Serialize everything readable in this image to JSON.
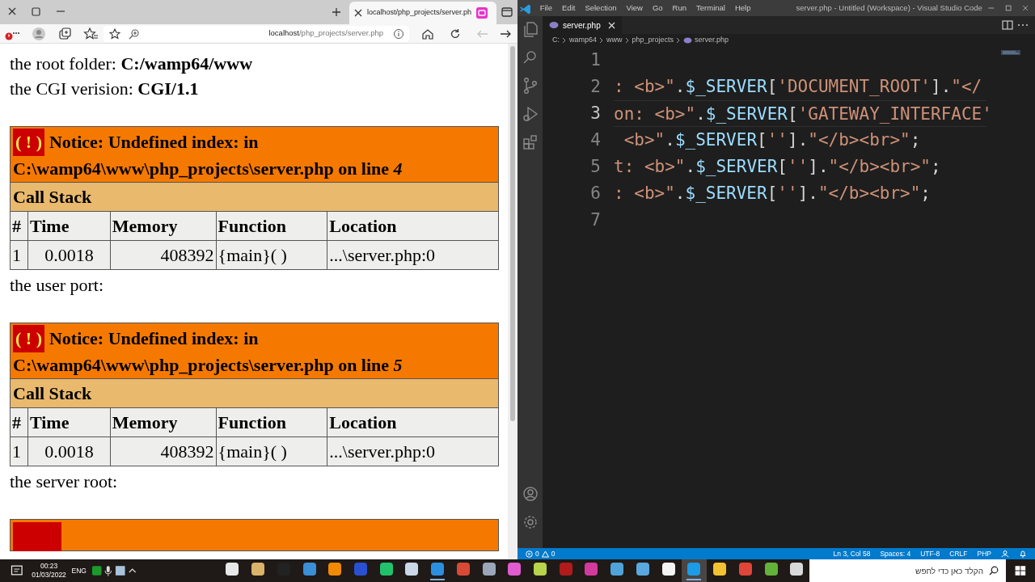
{
  "browser": {
    "tab": {
      "title": "localhost/php_projects/server.ph"
    },
    "address": {
      "host": "localhost",
      "path": "/php_projects/server.php"
    },
    "page": [
      {
        "kind": "text",
        "text": "the root folder: **C:/wamp64/www**"
      },
      {
        "kind": "text",
        "text": "the CGI verision: **CGI/1.1**"
      },
      {
        "kind": "notice",
        "badge": "( ! )",
        "message": "Notice: Undefined index: in C:\\wamp64\\www\\php_projects\\server.php on line *4*",
        "stack_title": "Call Stack",
        "columns": [
          "#",
          "Time",
          "Memory",
          "Function",
          "Location"
        ],
        "rows": [
          [
            "1",
            "0.0018",
            "408392",
            "{main}( )",
            "...\\server.php:0"
          ]
        ]
      },
      {
        "kind": "text",
        "text": "the user port:"
      },
      {
        "kind": "notice",
        "badge": "( ! )",
        "message": "Notice: Undefined index: in C:\\wamp64\\www\\php_projects\\server.php on line *5*",
        "stack_title": "Call Stack",
        "columns": [
          "#",
          "Time",
          "Memory",
          "Function",
          "Location"
        ],
        "rows": [
          [
            "1",
            "0.0018",
            "408392",
            "{main}( )",
            "...\\server.php:0"
          ]
        ]
      },
      {
        "kind": "text",
        "text": "the server root:"
      },
      {
        "kind": "notice_cut"
      }
    ]
  },
  "vscode": {
    "menu": [
      "File",
      "Edit",
      "Selection",
      "View",
      "Go",
      "Run",
      "Terminal",
      "Help"
    ],
    "title": "server.php - Untitled (Workspace) - Visual Studio Code",
    "tabs": [
      {
        "label": "server.php",
        "selected": true
      }
    ],
    "breadcrumb": [
      "C:",
      "wamp64",
      "www",
      "php_projects",
      "server.php"
    ],
    "lines": [
      {
        "number": "1",
        "current": false
      },
      {
        "number": "2",
        "current": false,
        "tokens": [
          {
            "kind": "str",
            "text": ": <b>\""
          },
          {
            "kind": "op",
            "text": "."
          },
          {
            "kind": "var",
            "text": "$_SERVER"
          },
          {
            "kind": "op",
            "text": "["
          },
          {
            "kind": "str",
            "text": "'DOCUMENT_ROOT'"
          },
          {
            "kind": "op",
            "text": "]."
          },
          {
            "kind": "str",
            "text": "\"</"
          }
        ]
      },
      {
        "number": "3",
        "current": true,
        "tokens": [
          {
            "kind": "str",
            "text": "on: <b>\""
          },
          {
            "kind": "op",
            "text": "."
          },
          {
            "kind": "var",
            "text": "$_SERVER"
          },
          {
            "kind": "op",
            "text": "["
          },
          {
            "kind": "str",
            "text": "'GATEWAY_INTERFACE'"
          }
        ]
      },
      {
        "number": "4",
        "current": false,
        "tokens": [
          {
            "kind": "str",
            "text": " <b>\""
          },
          {
            "kind": "op",
            "text": "."
          },
          {
            "kind": "var",
            "text": "$_SERVER"
          },
          {
            "kind": "op",
            "text": "["
          },
          {
            "kind": "str",
            "text": "''"
          },
          {
            "kind": "op",
            "text": "]."
          },
          {
            "kind": "str",
            "text": "\"</b><br>\""
          },
          {
            "kind": "op",
            "text": ";"
          }
        ]
      },
      {
        "number": "5",
        "current": false,
        "tokens": [
          {
            "kind": "str",
            "text": "t: <b>\""
          },
          {
            "kind": "op",
            "text": "."
          },
          {
            "kind": "var",
            "text": "$_SERVER"
          },
          {
            "kind": "op",
            "text": "["
          },
          {
            "kind": "str",
            "text": "''"
          },
          {
            "kind": "op",
            "text": "]."
          },
          {
            "kind": "str",
            "text": "\"</b><br>\""
          },
          {
            "kind": "op",
            "text": ";"
          }
        ]
      },
      {
        "number": "6",
        "current": false,
        "tokens": [
          {
            "kind": "str",
            "text": ": <b>\""
          },
          {
            "kind": "op",
            "text": "."
          },
          {
            "kind": "var",
            "text": "$_SERVER"
          },
          {
            "kind": "op",
            "text": "["
          },
          {
            "kind": "str",
            "text": "''"
          },
          {
            "kind": "op",
            "text": "]."
          },
          {
            "kind": "str",
            "text": "\"</b><br>\""
          },
          {
            "kind": "op",
            "text": ";"
          }
        ]
      },
      {
        "number": "7",
        "current": false
      }
    ],
    "status": {
      "errors": "0",
      "warnings": "0",
      "items": [
        "Ln 3, Col 58",
        "Spaces: 4",
        "UTF-8",
        "CRLF",
        "PHP"
      ]
    }
  },
  "taskbar": {
    "time": "00:23",
    "date": "01/03/2022",
    "language": "ENG",
    "search": {
      "placeholder": "הקלד כאן כדי לחפש"
    },
    "apps": [
      {
        "color": "#e8e8e8",
        "focused": false,
        "running": false
      },
      {
        "color": "#d9b36a",
        "focused": false,
        "running": false
      },
      {
        "color": "#222222",
        "focused": false,
        "running": false
      },
      {
        "color": "#3a8fd6",
        "focused": false,
        "running": false
      },
      {
        "color": "#f08a00",
        "focused": false,
        "running": false
      },
      {
        "color": "#2a4fd0",
        "focused": false,
        "running": false
      },
      {
        "color": "#21c26b",
        "focused": false,
        "running": false
      },
      {
        "color": "#c9d8e8",
        "focused": false,
        "running": false
      },
      {
        "color": "#2b8fe0",
        "focused": false,
        "running": true
      },
      {
        "color": "#d84a36",
        "focused": false,
        "running": false
      },
      {
        "color": "#9aa7b8",
        "focused": false,
        "running": false
      },
      {
        "color": "#e05cd0",
        "focused": false,
        "running": false
      },
      {
        "color": "#b7d44a",
        "focused": false,
        "running": false
      },
      {
        "color": "#b01b1b",
        "focused": false,
        "running": false
      },
      {
        "color": "#d23a9c",
        "focused": false,
        "running": false
      },
      {
        "color": "#4fa3d8",
        "focused": false,
        "running": false
      },
      {
        "color": "#5aa8e0",
        "focused": false,
        "running": false
      },
      {
        "color": "#f4f4f4",
        "focused": false,
        "running": false
      },
      {
        "color": "#1c9be6",
        "focused": true,
        "running": true
      },
      {
        "color": "#f3c232",
        "focused": false,
        "running": false
      },
      {
        "color": "#e0453a",
        "focused": false,
        "running": false
      },
      {
        "color": "#63b33a",
        "focused": false,
        "running": false
      },
      {
        "color": "#d9d9d9",
        "focused": false,
        "running": false
      }
    ]
  }
}
